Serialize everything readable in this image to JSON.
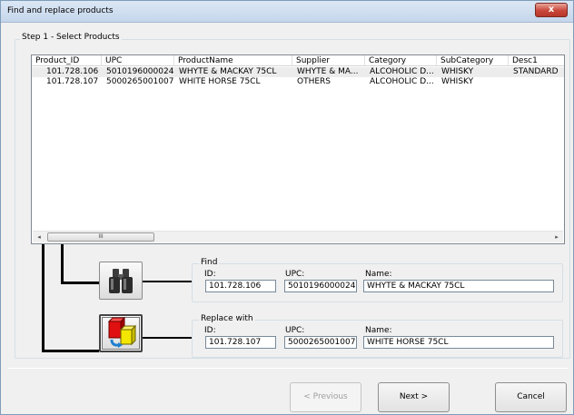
{
  "window": {
    "title": "Find and replace products",
    "close_glyph": "x"
  },
  "step1": {
    "legend": "Step 1 - Select Products",
    "columns": [
      "Product_ID",
      "UPC",
      "ProductName",
      "Supplier",
      "Category",
      "SubCategory",
      "Desc1"
    ],
    "rows": [
      [
        "101.728.106",
        "5010196000024",
        "WHYTE & MACKAY 75CL",
        "WHYTE & MA...",
        "ALCOHOLIC D...",
        "WHISKY",
        "STANDARD"
      ],
      [
        "101.728.107",
        "5000265001007",
        "WHITE HORSE 75CL",
        "OTHERS",
        "ALCOHOLIC D...",
        "WHISKY",
        ""
      ]
    ],
    "scroll": {
      "left_arrow": "◂",
      "right_arrow": "▸",
      "thumb_grip": "III"
    }
  },
  "find": {
    "legend": "Find",
    "id_label": "ID:",
    "upc_label": "UPC:",
    "name_label": "Name:",
    "id_value": "101.728.106",
    "upc_value": "5010196000024",
    "name_value": "WHYTE & MACKAY 75CL",
    "icon": "binoculars-icon"
  },
  "replace": {
    "legend": "Replace with",
    "id_label": "ID:",
    "upc_label": "UPC:",
    "name_label": "Name:",
    "id_value": "101.728.107",
    "upc_value": "5000265001007",
    "name_value": "WHITE HORSE 75CL",
    "icon": "replace-icon"
  },
  "buttons": {
    "previous": "< Previous",
    "next": "Next >",
    "cancel": "Cancel"
  }
}
